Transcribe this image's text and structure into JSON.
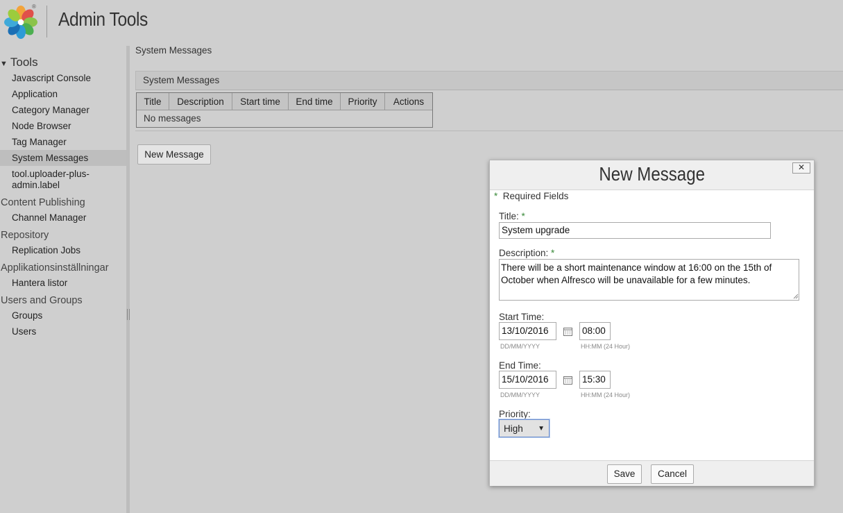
{
  "header": {
    "app_title": "Admin Tools",
    "logo": "alfresco-logo"
  },
  "sidebar": {
    "tools_label": "Tools",
    "tools_items": [
      "Javascript Console",
      "Application",
      "Category Manager",
      "Node Browser",
      "Tag Manager",
      "System Messages",
      "tool.uploader-plus-admin.label"
    ],
    "groups": [
      {
        "label": "Content Publishing",
        "items": [
          "Channel Manager"
        ]
      },
      {
        "label": "Repository",
        "items": [
          "Replication Jobs"
        ]
      },
      {
        "label": "Applikationsinställningar",
        "items": [
          "Hantera listor"
        ]
      },
      {
        "label": "Users and Groups",
        "items": [
          "Groups",
          "Users"
        ]
      }
    ]
  },
  "main": {
    "breadcrumb": "System Messages",
    "panel_title": "System Messages",
    "table_columns": [
      "Title",
      "Description",
      "Start time",
      "End time",
      "Priority",
      "Actions"
    ],
    "empty_text": "No messages",
    "new_message_label": "New Message"
  },
  "dialog": {
    "title": "New Message",
    "close_label": "✕",
    "required_note": "Required Fields",
    "required_star": "*",
    "title_label": "Title:",
    "title_value": "System upgrade",
    "description_label": "Description:",
    "description_value": "There will be a short maintenance window at 16:00 on the 15th of October when Alfresco will be unavailable for a few minutes.",
    "start_label": "Start Time:",
    "start_date": "13/10/2016",
    "start_time": "08:00",
    "end_label": "End Time:",
    "end_date": "15/10/2016",
    "end_time": "15:30",
    "date_hint": "DD/MM/YYYY",
    "time_hint": "HH:MM (24 Hour)",
    "priority_label": "Priority:",
    "priority_value": "High",
    "save_label": "Save",
    "cancel_label": "Cancel"
  },
  "colors": {
    "background": "#cfcfcf",
    "required_star": "#3a8a3a",
    "select_focus": "#6a8ccc"
  }
}
